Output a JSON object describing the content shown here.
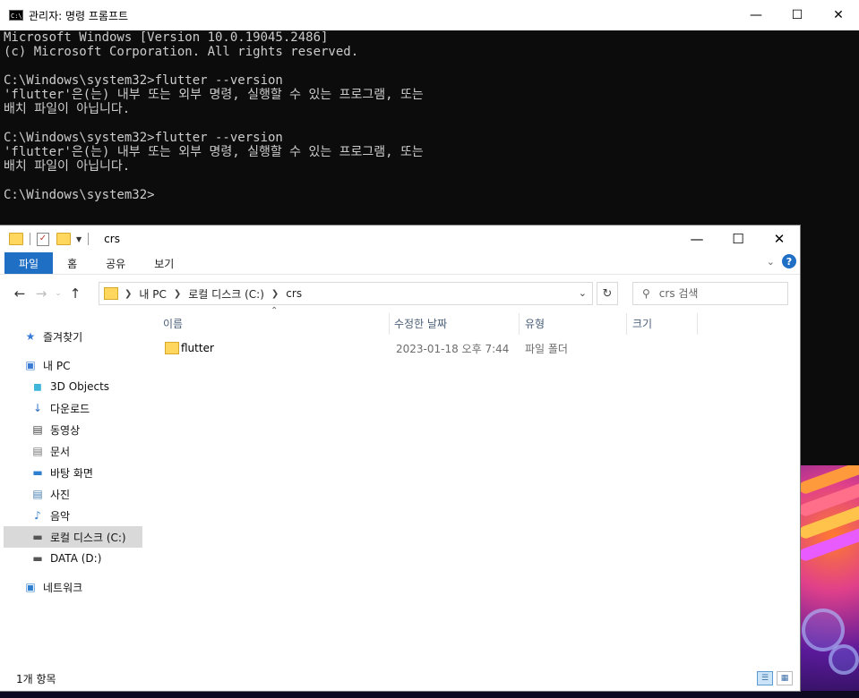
{
  "cmd": {
    "title": "관리자: 명령 프롬프트",
    "icon_text": "C:\\",
    "lines": [
      "Microsoft Windows [Version 10.0.19045.2486]",
      "(c) Microsoft Corporation. All rights reserved.",
      "",
      "C:\\Windows\\system32>flutter --version",
      "'flutter'은(는) 내부 또는 외부 명령, 실행할 수 있는 프로그램, 또는",
      "배치 파일이 아닙니다.",
      "",
      "C:\\Windows\\system32>flutter --version",
      "'flutter'은(는) 내부 또는 외부 명령, 실행할 수 있는 프로그램, 또는",
      "배치 파일이 아닙니다.",
      "",
      "C:\\Windows\\system32>"
    ]
  },
  "explorer": {
    "title": "crs",
    "ribbon_tabs": [
      "파일",
      "홈",
      "공유",
      "보기"
    ],
    "breadcrumb": [
      "내 PC",
      "로컬 디스크 (C:)",
      "crs"
    ],
    "search_placeholder": "crs 검색",
    "sidebar": [
      {
        "label": "즐겨찾기",
        "icon": "star-icon",
        "indent": 0
      },
      {
        "label": "내 PC",
        "icon": "computer-icon",
        "indent": 0
      },
      {
        "label": "3D Objects",
        "icon": "cube-icon",
        "indent": 1
      },
      {
        "label": "다운로드",
        "icon": "download-icon",
        "indent": 1
      },
      {
        "label": "동영상",
        "icon": "video-icon",
        "indent": 1
      },
      {
        "label": "문서",
        "icon": "document-icon",
        "indent": 1
      },
      {
        "label": "바탕 화면",
        "icon": "desktop-icon",
        "indent": 1
      },
      {
        "label": "사진",
        "icon": "picture-icon",
        "indent": 1
      },
      {
        "label": "음악",
        "icon": "music-icon",
        "indent": 1
      },
      {
        "label": "로컬 디스크 (C:)",
        "icon": "drive-icon",
        "indent": 1,
        "selected": true
      },
      {
        "label": "DATA (D:)",
        "icon": "drive-icon",
        "indent": 1
      },
      {
        "label": "네트워크",
        "icon": "network-icon",
        "indent": 0
      }
    ],
    "columns": [
      "이름",
      "수정한 날짜",
      "유형",
      "크기"
    ],
    "rows": [
      {
        "name": "flutter",
        "modified": "2023-01-18 오후 7:44",
        "type": "파일 폴더",
        "size": ""
      }
    ],
    "status": "1개 항목"
  }
}
